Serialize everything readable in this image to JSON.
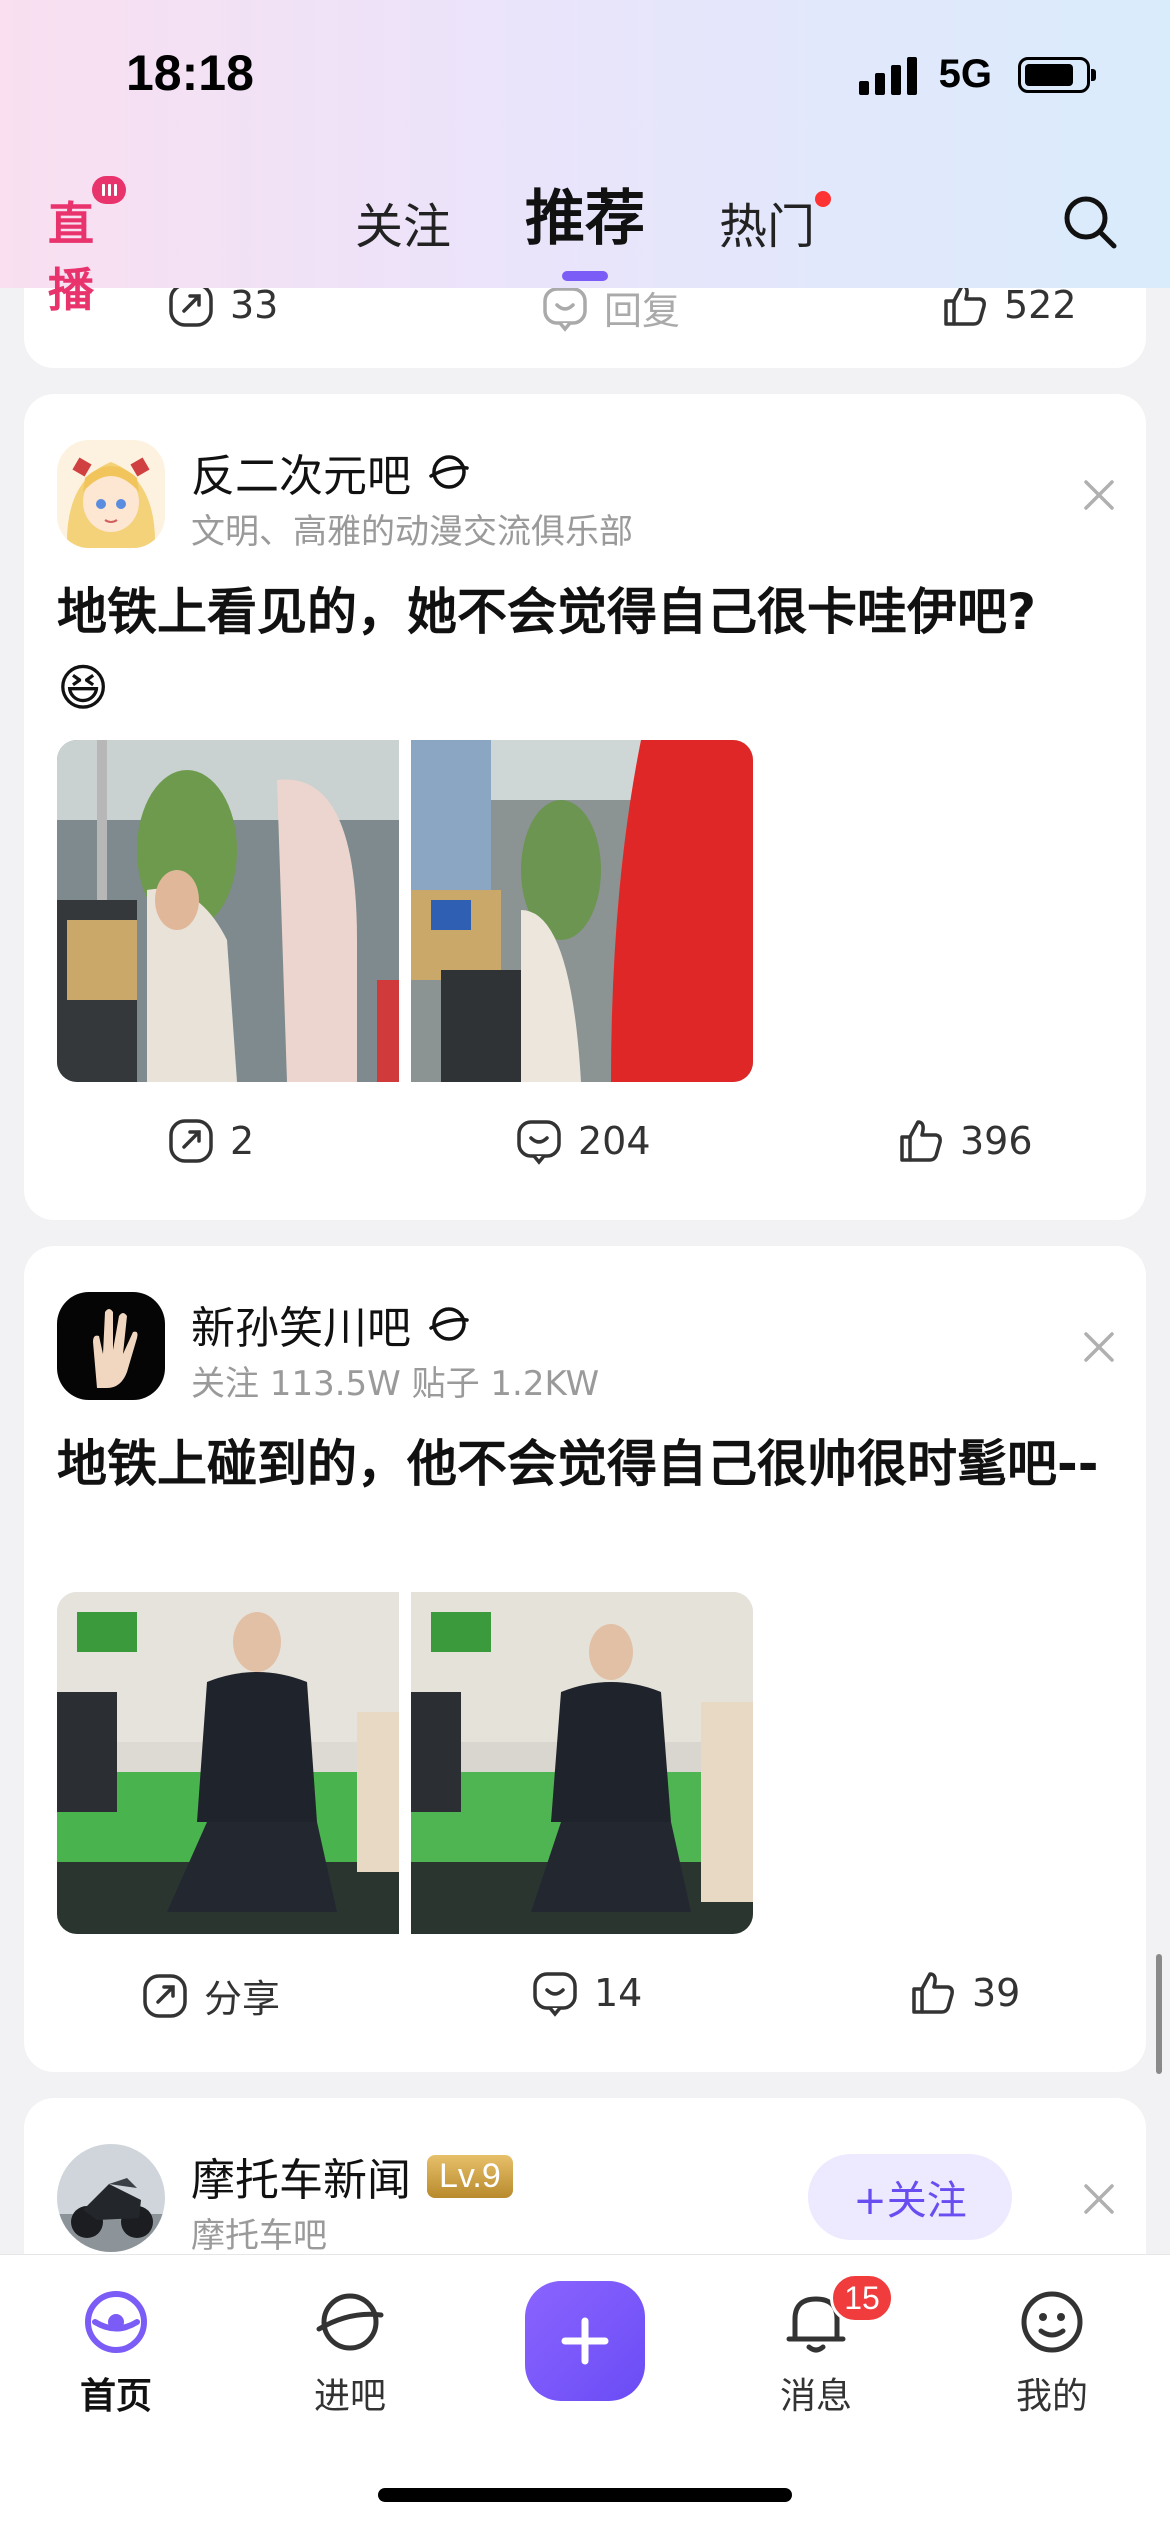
{
  "status_bar": {
    "time": "18:18",
    "network": "5G"
  },
  "header": {
    "live_label": "直播",
    "tabs": [
      {
        "label": "关注",
        "active": false,
        "dot": false
      },
      {
        "label": "推荐",
        "active": true,
        "dot": false
      },
      {
        "label": "热门",
        "active": false,
        "dot": true
      }
    ]
  },
  "prev_post": {
    "share_count": "33",
    "reply_label": "回复",
    "like_count": "522"
  },
  "posts": [
    {
      "forum_name": "反二次元吧",
      "forum_sub": "文明、高雅的动漫交流俱乐部",
      "title": "地铁上看见的，她不会觉得自己很卡哇伊吧?",
      "emoji": "😆",
      "share_count": "2",
      "comment_count": "204",
      "like_count": "396"
    },
    {
      "forum_name": "新孙笑川吧",
      "forum_sub": "关注 113.5W   贴子 1.2KW",
      "title": "地铁上碰到的，他不会觉得自己很帅很时髦吧--",
      "share_label": "分享",
      "comment_count": "14",
      "like_count": "39"
    },
    {
      "forum_name": "摩托车新闻",
      "level": "Lv.9",
      "forum_sub": "摩托车吧",
      "follow_label": "+关注"
    }
  ],
  "bottom_nav": {
    "items": [
      {
        "label": "首页",
        "icon": "home-icon"
      },
      {
        "label": "进吧",
        "icon": "planet-icon"
      },
      {
        "label": "消息",
        "icon": "bell-icon",
        "badge": "15"
      },
      {
        "label": "我的",
        "icon": "profile-icon"
      }
    ]
  },
  "colors": {
    "accent": "#7b5cf6",
    "live_pink": "#e8336d",
    "badge_red": "#f03c3c",
    "follow_bg": "#ede9ff"
  }
}
